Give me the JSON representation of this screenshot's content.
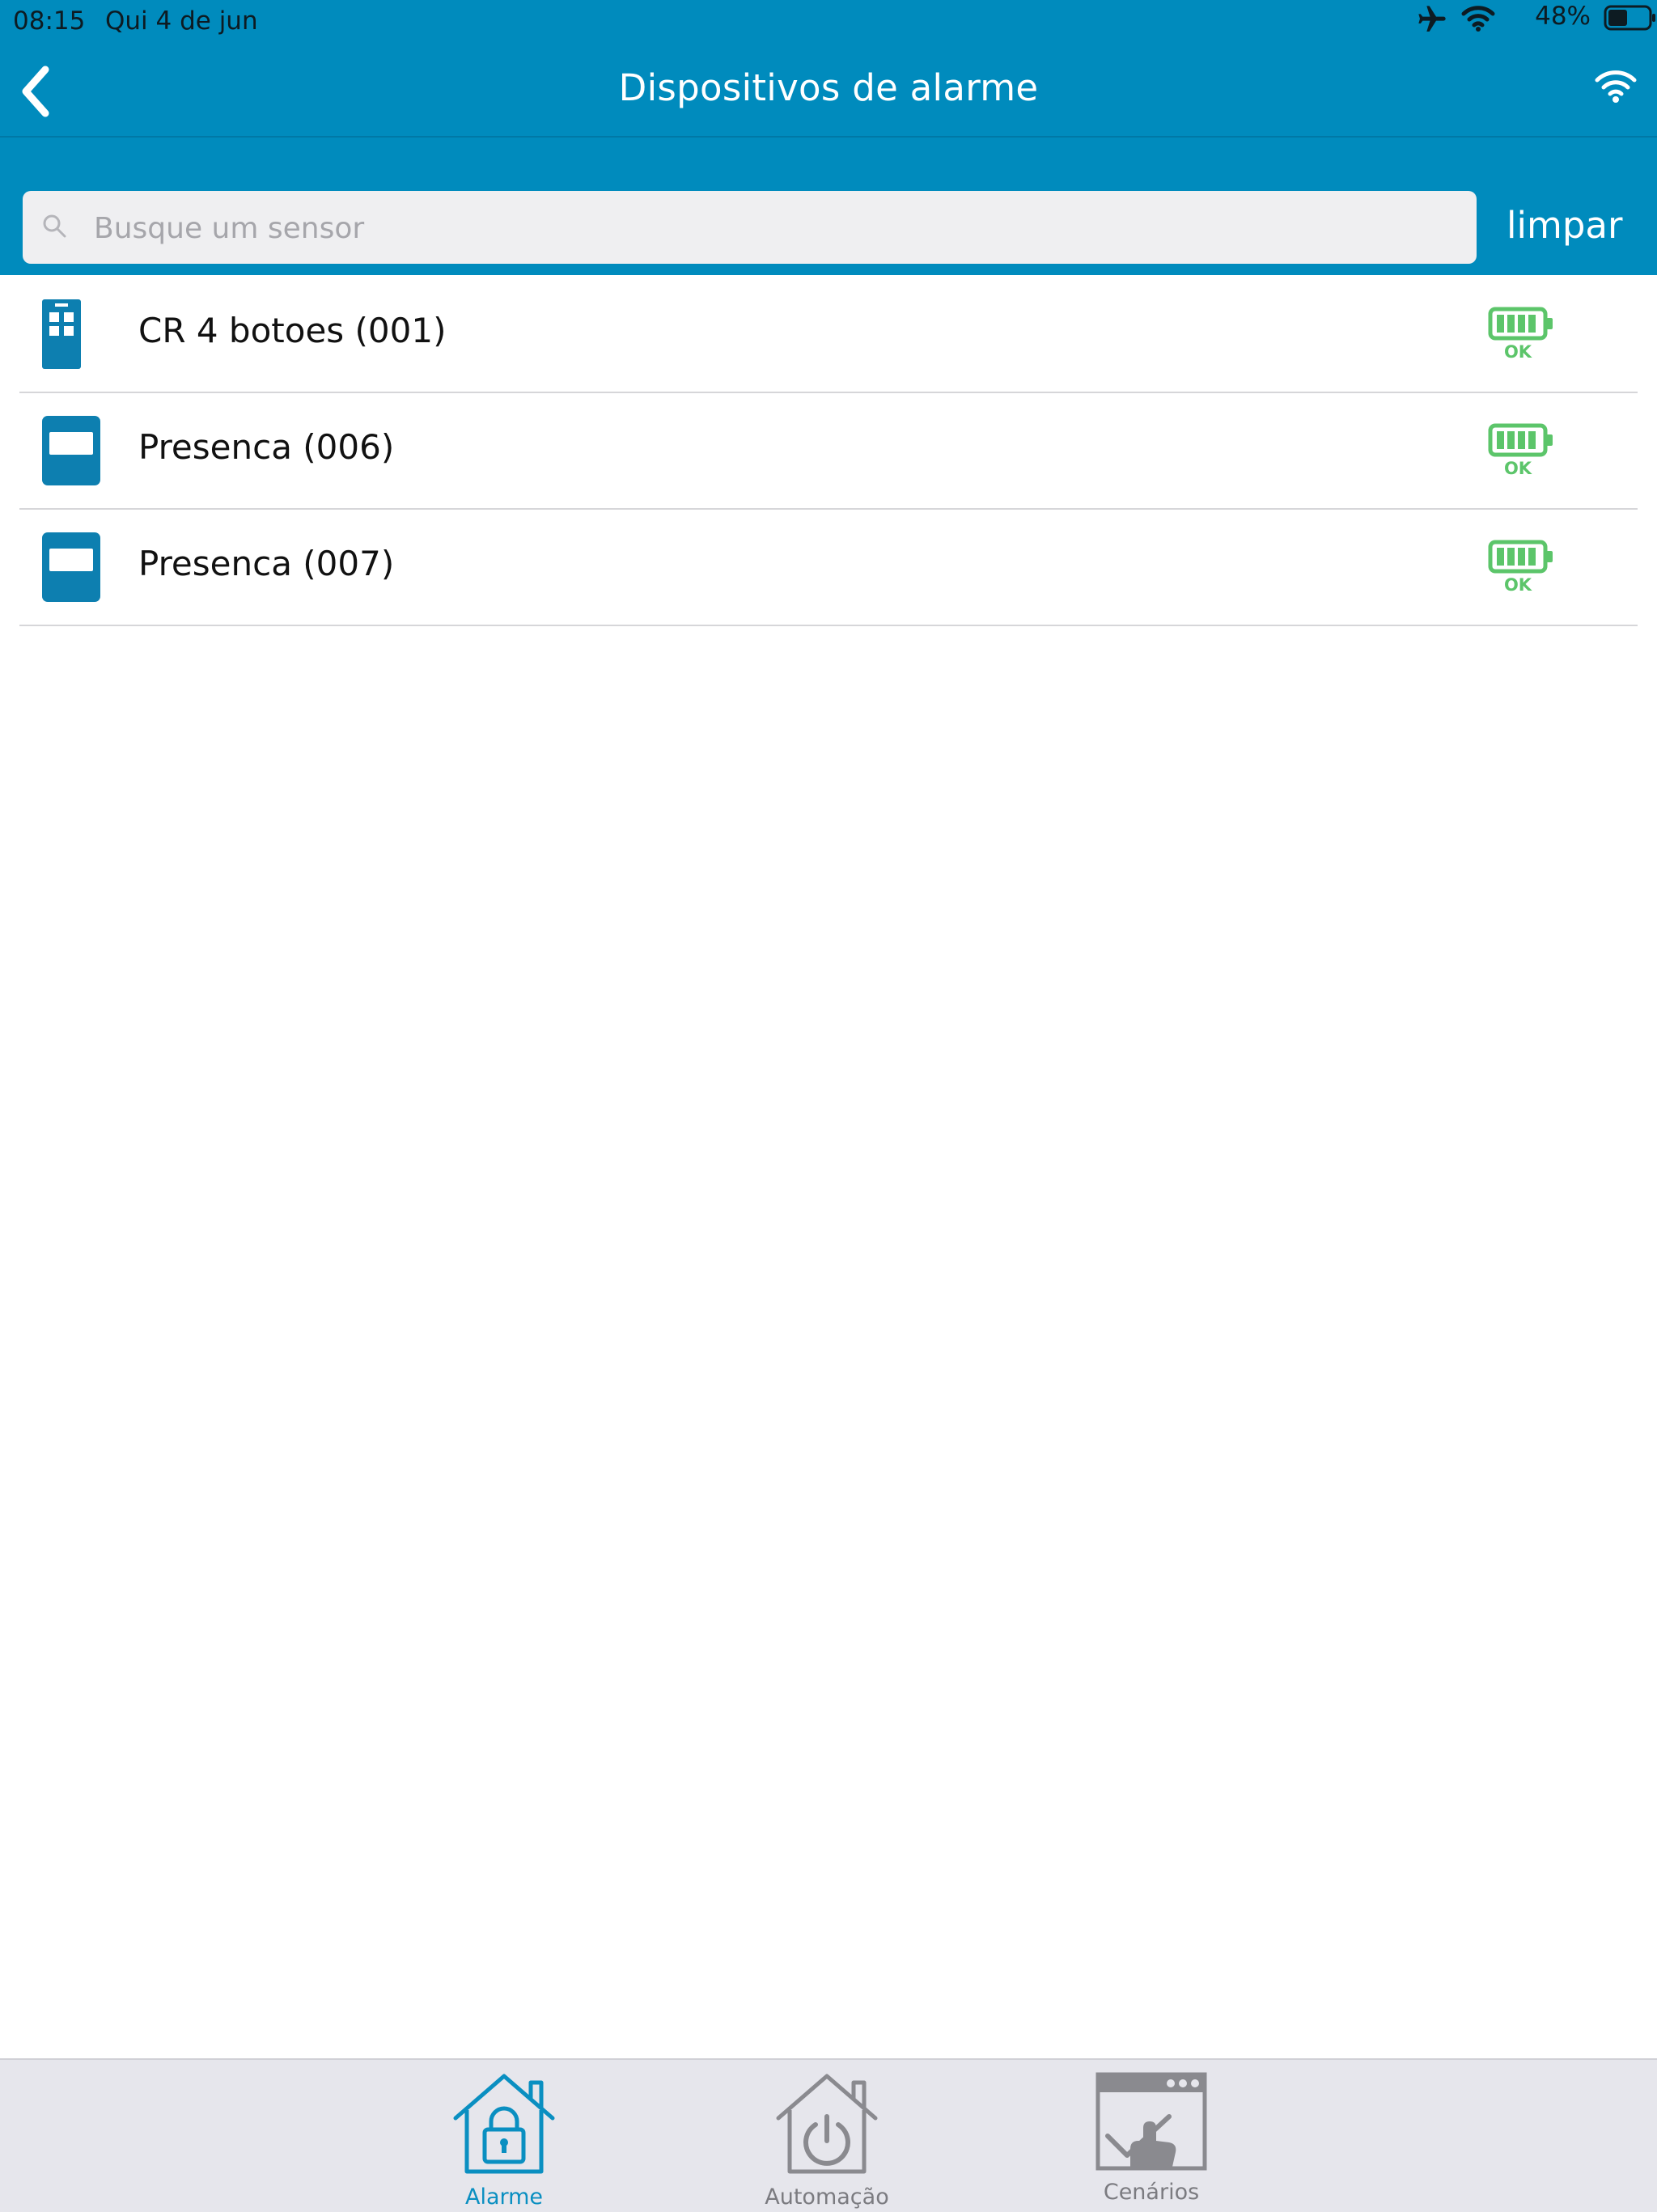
{
  "status_bar": {
    "time": "08:15",
    "date": "Qui 4 de jun",
    "battery_percent": "48%",
    "battery_level": 0.48,
    "icons": [
      "airplane-icon",
      "wifi-icon",
      "battery-icon"
    ]
  },
  "nav": {
    "title": "Dispositivos de alarme",
    "back_icon": "chevron-left-icon",
    "right_icon": "wifi-connection-icon"
  },
  "search": {
    "placeholder": "Busque um sensor",
    "value": "",
    "clear_label": "limpar"
  },
  "devices": [
    {
      "name": "CR 4 botoes (001)",
      "icon": "remote-control-icon",
      "battery": "OK"
    },
    {
      "name": "Presenca (006)",
      "icon": "motion-sensor-icon",
      "battery": "OK"
    },
    {
      "name": "Presenca (007)",
      "icon": "motion-sensor-icon",
      "battery": "OK"
    }
  ],
  "tabs": [
    {
      "label": "Alarme",
      "icon": "house-lock-icon",
      "active": true
    },
    {
      "label": "Automação",
      "icon": "house-power-icon",
      "active": false
    },
    {
      "label": "Cenários",
      "icon": "scene-touch-icon",
      "active": false
    }
  ],
  "colors": {
    "brand_blue": "#008bbd",
    "device_icon_blue": "#0d7fb0",
    "battery_ok_green": "#5cc56a",
    "tab_active": "#0a8fc1",
    "tab_inactive": "#8a8a8f"
  }
}
